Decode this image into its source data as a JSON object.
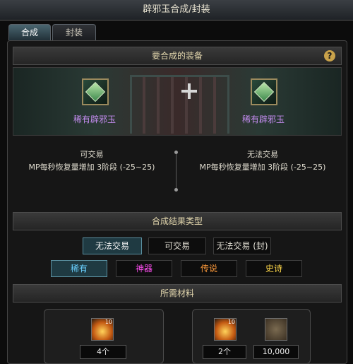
{
  "window": {
    "title": "辟邪玉合成/封装"
  },
  "tabs": [
    {
      "label": "合成",
      "active": true
    },
    {
      "label": "封装",
      "active": false
    }
  ],
  "equipment_section": {
    "header": "要合成的装备",
    "help_icon": "?",
    "left_item": {
      "name": "稀有辟邪玉",
      "icon": "jade-gem-icon"
    },
    "right_item": {
      "name": "稀有辟邪玉",
      "icon": "jade-gem-icon"
    },
    "left_info": {
      "trade": "可交易",
      "effect": "MP每秒恢复量增加 3阶段 (-25~25)"
    },
    "right_info": {
      "trade": "无法交易",
      "effect": "MP每秒恢复量增加 3阶段 (-25~25)"
    }
  },
  "result_section": {
    "header": "合成结果类型",
    "trade_options": [
      {
        "label": "无法交易",
        "selected": true
      },
      {
        "label": "可交易",
        "selected": false
      },
      {
        "label": "无法交易 (封)",
        "selected": false
      }
    ],
    "rarity_options": [
      {
        "label": "稀有",
        "selected": true,
        "color": "#6ad0ff"
      },
      {
        "label": "神器",
        "selected": false,
        "color": "#ff4df0"
      },
      {
        "label": "传说",
        "selected": false,
        "color": "#ff9a3a"
      },
      {
        "label": "史诗",
        "selected": false,
        "color": "#ffd84a"
      }
    ]
  },
  "materials_section": {
    "header": "所需材料",
    "left_box": {
      "icon": "flame-crystal-icon",
      "stack": "10",
      "count": "4个"
    },
    "right_box": {
      "icon": "flame-crystal-icon",
      "stack": "10",
      "count": "2个",
      "coin_icon": "gold-coin-icon",
      "gold": "10,000"
    }
  }
}
